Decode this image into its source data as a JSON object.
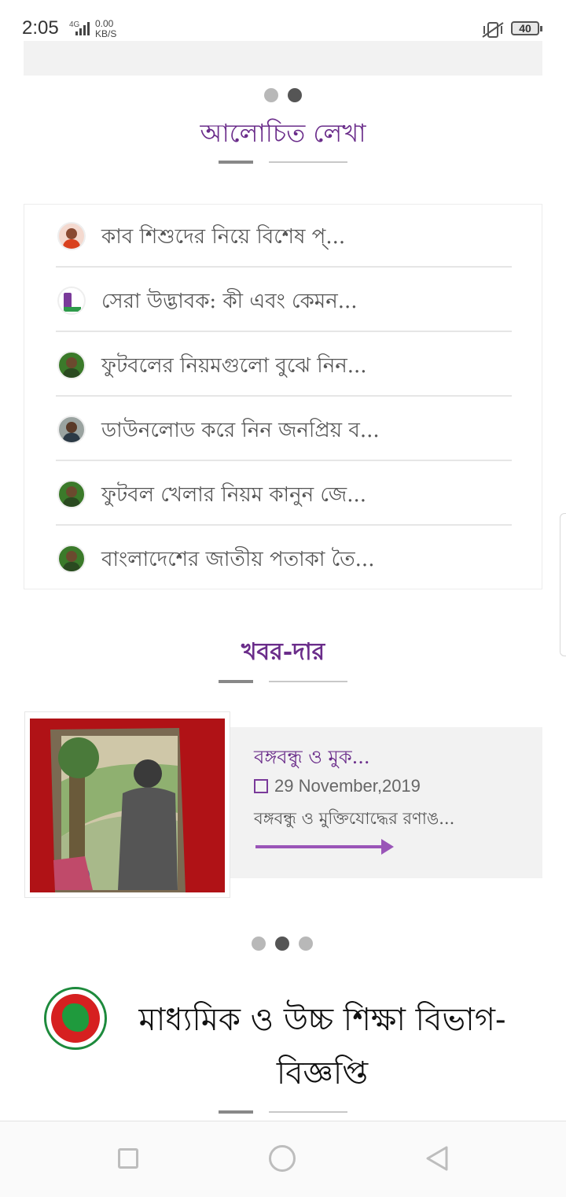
{
  "status_bar": {
    "time": "2:05",
    "network": "4G",
    "speed_value": "0.00",
    "speed_unit": "KB/S",
    "battery": "40"
  },
  "carousel_top": {
    "dots": 2,
    "active_index": 1
  },
  "discussed_section": {
    "title": "আলোচিত লেখা",
    "items": [
      {
        "text": "কাব শিশুদের নিয়ে বিশেষ প্...",
        "avatar": "person-red-avatar"
      },
      {
        "text": "সেরা উদ্ভাবক: কী এবং কেমন...",
        "avatar": "logo-avatar"
      },
      {
        "text": "ফুটবলের নিয়মগুলো বুঝে নিন...",
        "avatar": "person-green-avatar"
      },
      {
        "text": "ডাউনলোড করে নিন জনপ্রিয় ব...",
        "avatar": "person-glasses-avatar"
      },
      {
        "text": "ফুটবল খেলার নিয়ম কানুন জে...",
        "avatar": "person-green-avatar"
      },
      {
        "text": "বাংলাদেশের জাতীয় পতাকা তৈ...",
        "avatar": "person-green-avatar"
      }
    ]
  },
  "news_section": {
    "title": "খবর-দার",
    "card": {
      "title": "বঙ্গবন্ধু ও মুক...",
      "date": "29 November,2019",
      "excerpt": "বঙ্গবন্ধু ও মুক্তিযোদ্ধের রণাঙ...",
      "image": "bangabandhu-painting"
    },
    "dots": 3,
    "active_index": 1
  },
  "department_section": {
    "title": "মাধ্যমিক ও উচ্চ শিক্ষা বিভাগ-বিজ্ঞপ্তি",
    "logo": "government-seal-icon"
  },
  "colors": {
    "accent": "#6a2c8a",
    "panel": "#f2f2f2",
    "seal_red": "#d62020",
    "seal_green": "#1f9a3d"
  },
  "nav_bar": {
    "icons": [
      "recent-apps-icon",
      "home-icon",
      "back-icon"
    ]
  }
}
